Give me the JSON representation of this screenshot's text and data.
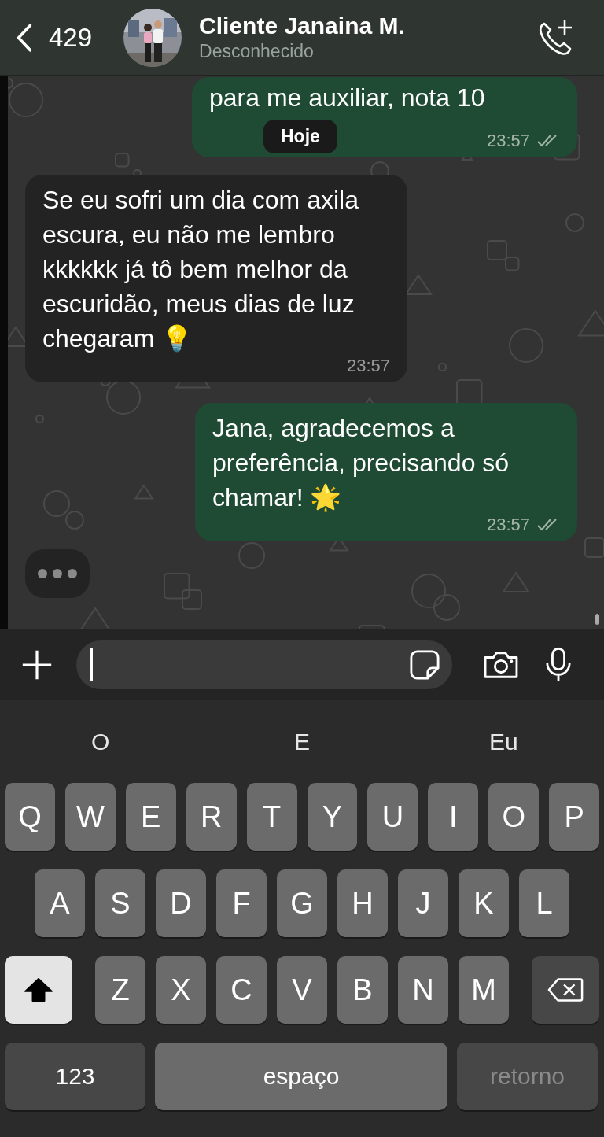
{
  "header": {
    "back_count": "429",
    "contact_name": "Cliente Janaina M.",
    "subtitle": "Desconhecido"
  },
  "messages": [
    {
      "kind": "out",
      "text": "para me auxiliar, nota 10",
      "time": "23:57",
      "read": true
    },
    {
      "kind": "in",
      "text": "Se eu sofri um dia com axila escura, eu não me lembro kkkkkk já tô bem melhor da escuridão, meus dias de luz chegaram 💡",
      "time": "23:57"
    },
    {
      "kind": "out",
      "text": "Jana, agradecemos a preferência, precisando só chamar! 🌟",
      "time": "23:57",
      "read": true
    }
  ],
  "date_pill": "Hoje",
  "typing": true,
  "suggestions": [
    "O",
    "E",
    "Eu"
  ],
  "keyboard": {
    "rows": [
      [
        "Q",
        "W",
        "E",
        "R",
        "T",
        "Y",
        "U",
        "I",
        "O",
        "P"
      ],
      [
        "A",
        "S",
        "D",
        "F",
        "G",
        "H",
        "J",
        "K",
        "L"
      ],
      [
        "Z",
        "X",
        "C",
        "V",
        "B",
        "N",
        "M"
      ]
    ],
    "shift_on": true,
    "numbers_key": "123",
    "space_key": "espaço",
    "return_key": "retorno",
    "return_disabled": true
  }
}
